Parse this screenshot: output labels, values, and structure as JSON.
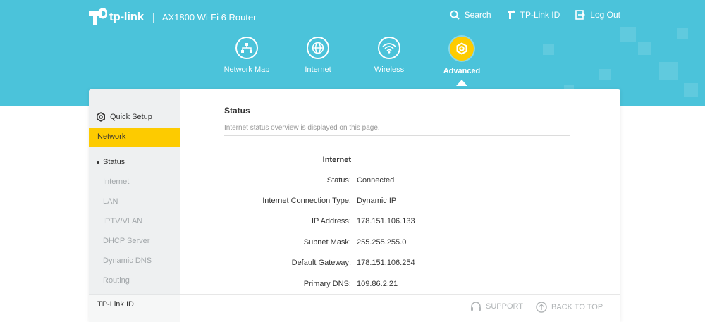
{
  "header": {
    "brand": "tp-link",
    "model": "AX1800 Wi-Fi 6 Router",
    "links": [
      {
        "label": "Search",
        "icon": "search-icon"
      },
      {
        "label": "TP-Link ID",
        "icon": "tplink-id-icon"
      },
      {
        "label": "Log Out",
        "icon": "logout-icon"
      }
    ]
  },
  "nav": {
    "items": [
      {
        "label": "Network Map",
        "icon": "network-map-icon"
      },
      {
        "label": "Internet",
        "icon": "globe-icon"
      },
      {
        "label": "Wireless",
        "icon": "wifi-icon"
      },
      {
        "label": "Advanced",
        "icon": "gear-icon",
        "active": true
      }
    ]
  },
  "sidebar": {
    "quick_setup": "Quick Setup",
    "section": "Network",
    "items": [
      "Status",
      "Internet",
      "LAN",
      "IPTV/VLAN",
      "DHCP Server",
      "Dynamic DNS",
      "Routing"
    ],
    "active_item": "Status",
    "bottom": "TP-Link ID"
  },
  "content": {
    "title": "Status",
    "description": "Internet status overview is displayed on this page.",
    "section": "Internet",
    "rows": [
      {
        "label": "Status:",
        "value": "Connected"
      },
      {
        "label": "Internet Connection Type:",
        "value": "Dynamic IP"
      },
      {
        "label": "IP Address:",
        "value": "178.151.106.133"
      },
      {
        "label": "Subnet Mask:",
        "value": "255.255.255.0"
      },
      {
        "label": "Default Gateway:",
        "value": "178.151.106.254"
      },
      {
        "label": "Primary DNS:",
        "value": "109.86.2.21"
      }
    ]
  },
  "footer": {
    "support": "SUPPORT",
    "back_to_top": "BACK TO TOP"
  },
  "colors": {
    "header_bg": "#4bc3da",
    "accent": "#fdcb00",
    "sidebar_bg": "#eef0f1"
  }
}
